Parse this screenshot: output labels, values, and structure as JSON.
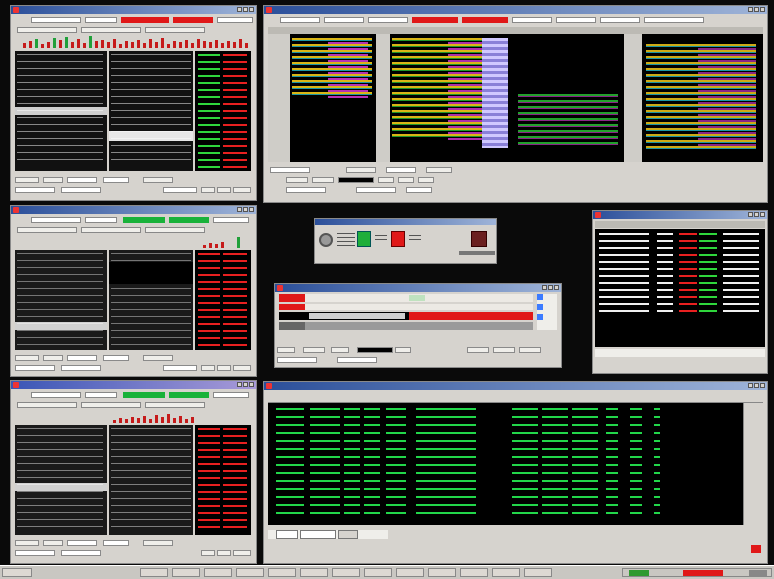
{
  "desktop": {
    "left_windows": [
      {
        "id": "quote-a",
        "title": "",
        "active": false
      },
      {
        "id": "quote-b",
        "title": "",
        "active": false
      },
      {
        "id": "quote-c",
        "title": "",
        "active": true
      }
    ],
    "top_grid_window": {
      "title": ""
    },
    "dialog": {
      "title": ""
    },
    "order_entry": {
      "title": ""
    },
    "summary": {
      "title": ""
    },
    "executions": {
      "title": "",
      "tabs": [
        "",
        "",
        ""
      ]
    }
  },
  "taskbar": {
    "start_label": "",
    "items": [
      "",
      "",
      "",
      "",
      "",
      "",
      "",
      "",
      "",
      "",
      "",
      "",
      "",
      "",
      ""
    ]
  },
  "colors": {
    "ask": "#e01818",
    "bid": "#19b23a",
    "fills": "#22d64a",
    "grid_bg": "#000000",
    "window_face": "#d6d3ce"
  }
}
